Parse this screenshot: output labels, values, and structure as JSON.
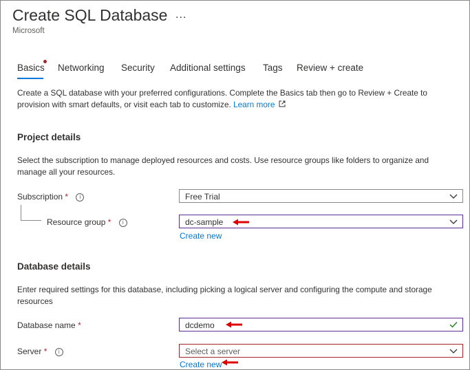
{
  "header": {
    "title": "Create SQL Database",
    "more": "...",
    "publisher": "Microsoft"
  },
  "tabs": [
    {
      "label": "Basics",
      "active": true,
      "has_error": true
    },
    {
      "label": "Networking"
    },
    {
      "label": "Security"
    },
    {
      "label": "Additional settings"
    },
    {
      "label": "Tags"
    },
    {
      "label": "Review + create"
    }
  ],
  "intro": {
    "text": "Create a SQL database with your preferred configurations. Complete the Basics tab then go to Review + Create to provision with smart defaults, or visit each tab to customize.",
    "learn_more": "Learn more"
  },
  "project": {
    "heading": "Project details",
    "description": "Select the subscription to manage deployed resources and costs. Use resource groups like folders to organize and manage all your resources.",
    "subscription_label": "Subscription",
    "subscription_value": "Free Trial",
    "resource_group_label": "Resource group",
    "resource_group_value": "dc-sample",
    "create_new": "Create new"
  },
  "database": {
    "heading": "Database details",
    "description": "Enter required settings for this database, including picking a logical server and configuring the compute and storage resources",
    "name_label": "Database name",
    "name_value": "dcdemo",
    "server_label": "Server",
    "server_placeholder": "Select a server",
    "create_new": "Create new"
  },
  "ui": {
    "required_mark": "*",
    "info_glyph": "i"
  },
  "colors": {
    "accent": "#0078d4",
    "error": "#a4262c",
    "annotation_arrow": "#e00000",
    "success": "#107c10"
  },
  "icons": [
    "more-icon",
    "info-icon",
    "chevron-down-icon",
    "checkmark-icon",
    "external-link-icon",
    "red-arrow-annotation"
  ]
}
